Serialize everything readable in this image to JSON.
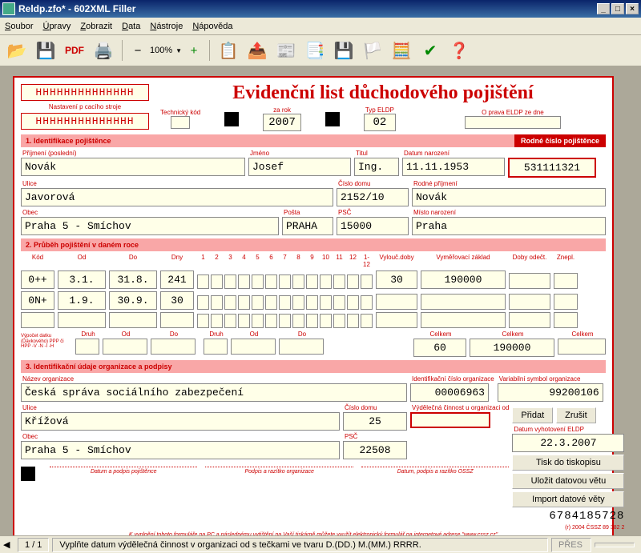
{
  "window": {
    "title": "Reldp.zfo* - 602XML Filler",
    "min": "_",
    "max": "□",
    "close": "×"
  },
  "menu": {
    "soubor": "Soubor",
    "upravy": "Úpravy",
    "zobrazit": "Zobrazit",
    "data": "Data",
    "nastroje": "Nástroje",
    "napoveda": "Nápověda"
  },
  "toolbar": {
    "zoom": "100%"
  },
  "header": {
    "h1": "HHHHHHHHHHHHHH",
    "h2": "HHHHHHHHHHHHHH",
    "nastaveni": "Nastavení p cacího stroje",
    "title": "Evidenční list důchodového pojištění",
    "tech": "Technický kód",
    "zarok": "za rok",
    "rok": "2007",
    "typ": "Typ ELDP",
    "typ_val": "02",
    "oprava": "O prava ELDP ze dne"
  },
  "sec1": {
    "title": "1. Identifikace pojištěnce",
    "rodne_title": "Rodné číslo pojištěnce",
    "prijmeni_l": "Příjmení (poslední)",
    "prijmeni": "Novák",
    "jmeno_l": "Jméno",
    "jmeno": "Josef",
    "titul_l": "Titul",
    "titul": "Ing.",
    "narozeni_l": "Datum narození",
    "narozeni": "11.11.1953",
    "rc": "531111321",
    "ulice_l": "Ulice",
    "ulice": "Javorová",
    "cislo_l": "Číslo domu",
    "cislo": "2152/10",
    "rodne_p_l": "Rodné příjmení",
    "rodne_p": "Novák",
    "obec_l": "Obec",
    "obec": "Praha 5 - Smíchov",
    "posta_l": "Pošta",
    "posta": "PRAHA",
    "psc_l": "PSČ",
    "psc": "15000",
    "misto_l": "Místo narození",
    "misto": "Praha"
  },
  "sec2": {
    "title": "2. Průběh pojištění v daném roce",
    "kod_l": "Kód",
    "od_l": "Od",
    "do_l": "Do",
    "dny_l": "Dny",
    "vyl_l": "Vylouč.doby",
    "zaklad_l": "Vyměřovací základ",
    "odect_l": "Doby odečt.",
    "znepl_l": "Znepl.",
    "druh_l": "Druh",
    "celkem_l": "Celkem",
    "rows": [
      {
        "kod": "0++",
        "od": "3.1.",
        "do": "31.8.",
        "dny": "241",
        "vyl": "30",
        "zaklad": "190000",
        "odect": "",
        "znepl": ""
      },
      {
        "kod": "0N+",
        "od": "1.9.",
        "do": "30.9.",
        "dny": "30",
        "vyl": "",
        "zaklad": "",
        "odect": "",
        "znepl": ""
      },
      {
        "kod": "",
        "od": "",
        "do": "",
        "dny": "",
        "vyl": "",
        "zaklad": "",
        "odect": "",
        "znepl": ""
      }
    ],
    "vysv": "Výpočet datku (Dávkového) PPP či HPP -V -N -I -H",
    "celkem_vyl": "60",
    "celkem_zaklad": "190000",
    "celkem_odect": ""
  },
  "sec3": {
    "title": "3. Identifikační údaje organizace a podpisy",
    "nazev_l": "Název organizace",
    "nazev": "Česká správa sociálního zabezpečení",
    "ic_l": "Identifikační číslo organizace",
    "ic": "00006963",
    "vs_l": "Variabilní symbol organizace",
    "vs": "99200106",
    "ulice_l": "Ulice",
    "ulice": "Křížová",
    "cislo_l": "Číslo domu",
    "cislo": "25",
    "vydel_l": "Výdělečná činnost u organizaci od",
    "vydel": "",
    "obec_l": "Obec",
    "obec": "Praha 5 - Smíchov",
    "psc_l": "PSČ",
    "psc": "22508",
    "pridat": "Přidat",
    "zrusit": "Zrušit",
    "datum_vyh_l": "Datum vyhotovení ELDP",
    "datum_vyh": "22.3.2007",
    "tisk": "Tisk do tiskopisu",
    "ulozit": "Uložit datovou větu",
    "import": "Import datové věty",
    "num": "6784185728",
    "sig1": "Datum a podpis pojištěnce",
    "sig2": "Podpis a razítko organizace",
    "sig3": "Datum, podpis a razítko OSSZ",
    "cred": "(r) 2004 ČSSZ 89 382 2",
    "footer": "K vyplnění tohoto formuláře na PC a následnému vytištění na Vaší tiskárně můžete využít elektronický formulář na internetové adrese \"www.cssz.cz\""
  },
  "status": {
    "page": "1 / 1",
    "hint": "Vyplňte datum výdělečná činnost v organizaci od s tečkami ve tvaru D.(DD.) M.(MM.) RRRR.",
    "pres": "PŘES"
  }
}
